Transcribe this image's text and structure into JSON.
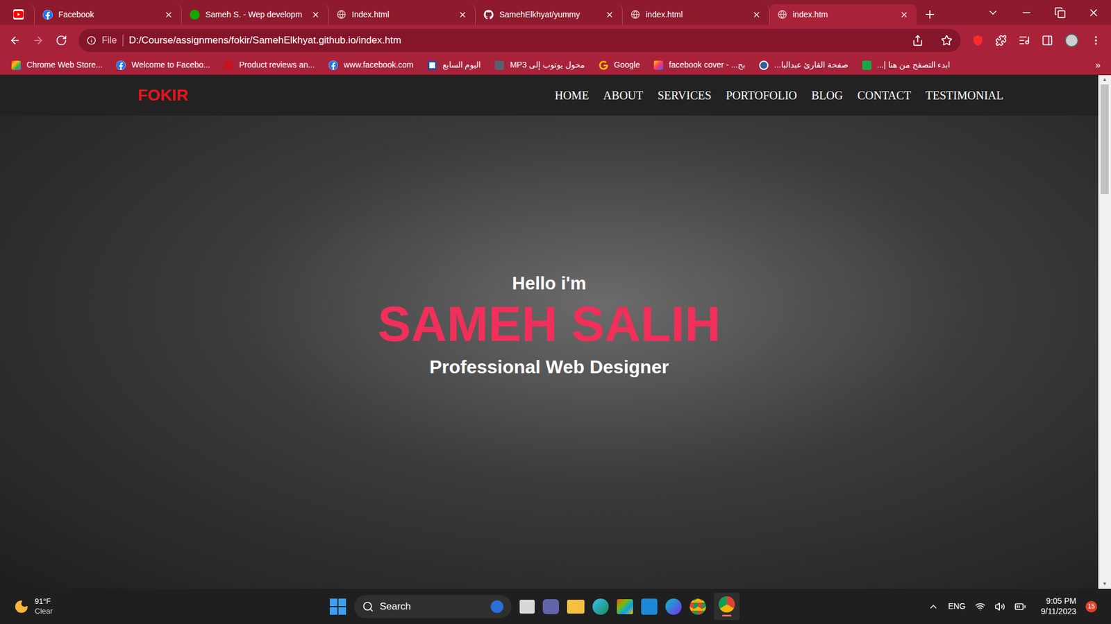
{
  "browser": {
    "pinned_tabs": [
      {
        "icon": "youtube",
        "selected": false
      }
    ],
    "tabs": [
      {
        "label": "Facebook",
        "icon": "facebook",
        "selected": false
      },
      {
        "label": "Sameh S. - Wep developm",
        "icon": "upwork",
        "selected": false
      },
      {
        "label": "Index.html",
        "icon": "globe",
        "selected": false
      },
      {
        "label": "SamehElkhyat/yummy",
        "icon": "github",
        "selected": false
      },
      {
        "label": "index.html",
        "icon": "globe",
        "selected": false
      },
      {
        "label": "index.htm",
        "icon": "globe",
        "selected": true
      }
    ],
    "address": {
      "scheme": "File",
      "url": "D:/Course/assignmens/fokir/SamehElkhyat.github.io/index.htm"
    },
    "bookmarks": [
      {
        "label": "Chrome Web Store...",
        "icon": "store"
      },
      {
        "label": "Welcome to Facebo...",
        "icon": "facebook"
      },
      {
        "label": "Product reviews an...",
        "icon": "red"
      },
      {
        "label": "www.facebook.com",
        "icon": "facebook"
      },
      {
        "label": "اليوم السابع",
        "icon": "news"
      },
      {
        "label": "محول يوتوب إلى MP3",
        "icon": "music"
      },
      {
        "label": "Google",
        "icon": "google"
      },
      {
        "label": "facebook cover - ...بح",
        "icon": "image"
      },
      {
        "label": "صفحة القارئ عبدالبا...",
        "icon": "quran"
      },
      {
        "label": "ابدء التصفح من هنا |...",
        "icon": "green"
      }
    ],
    "more": "»"
  },
  "page": {
    "logo": "FOKIR",
    "nav": [
      "HOME",
      "ABOUT",
      "SERVICES",
      "PORTOFOLIO",
      "BLOG",
      "CONTACT",
      "TESTIMONIAL"
    ],
    "hero": {
      "greeting": "Hello i'm",
      "name": "SAMEH SALIH",
      "role": "Professional Web Designer"
    }
  },
  "taskbar": {
    "weather": {
      "temp": "91°F",
      "condition": "Clear"
    },
    "search": "Search",
    "language": "ENG",
    "time": "9:05 PM",
    "date": "9/11/2023",
    "notifications": "15"
  }
}
